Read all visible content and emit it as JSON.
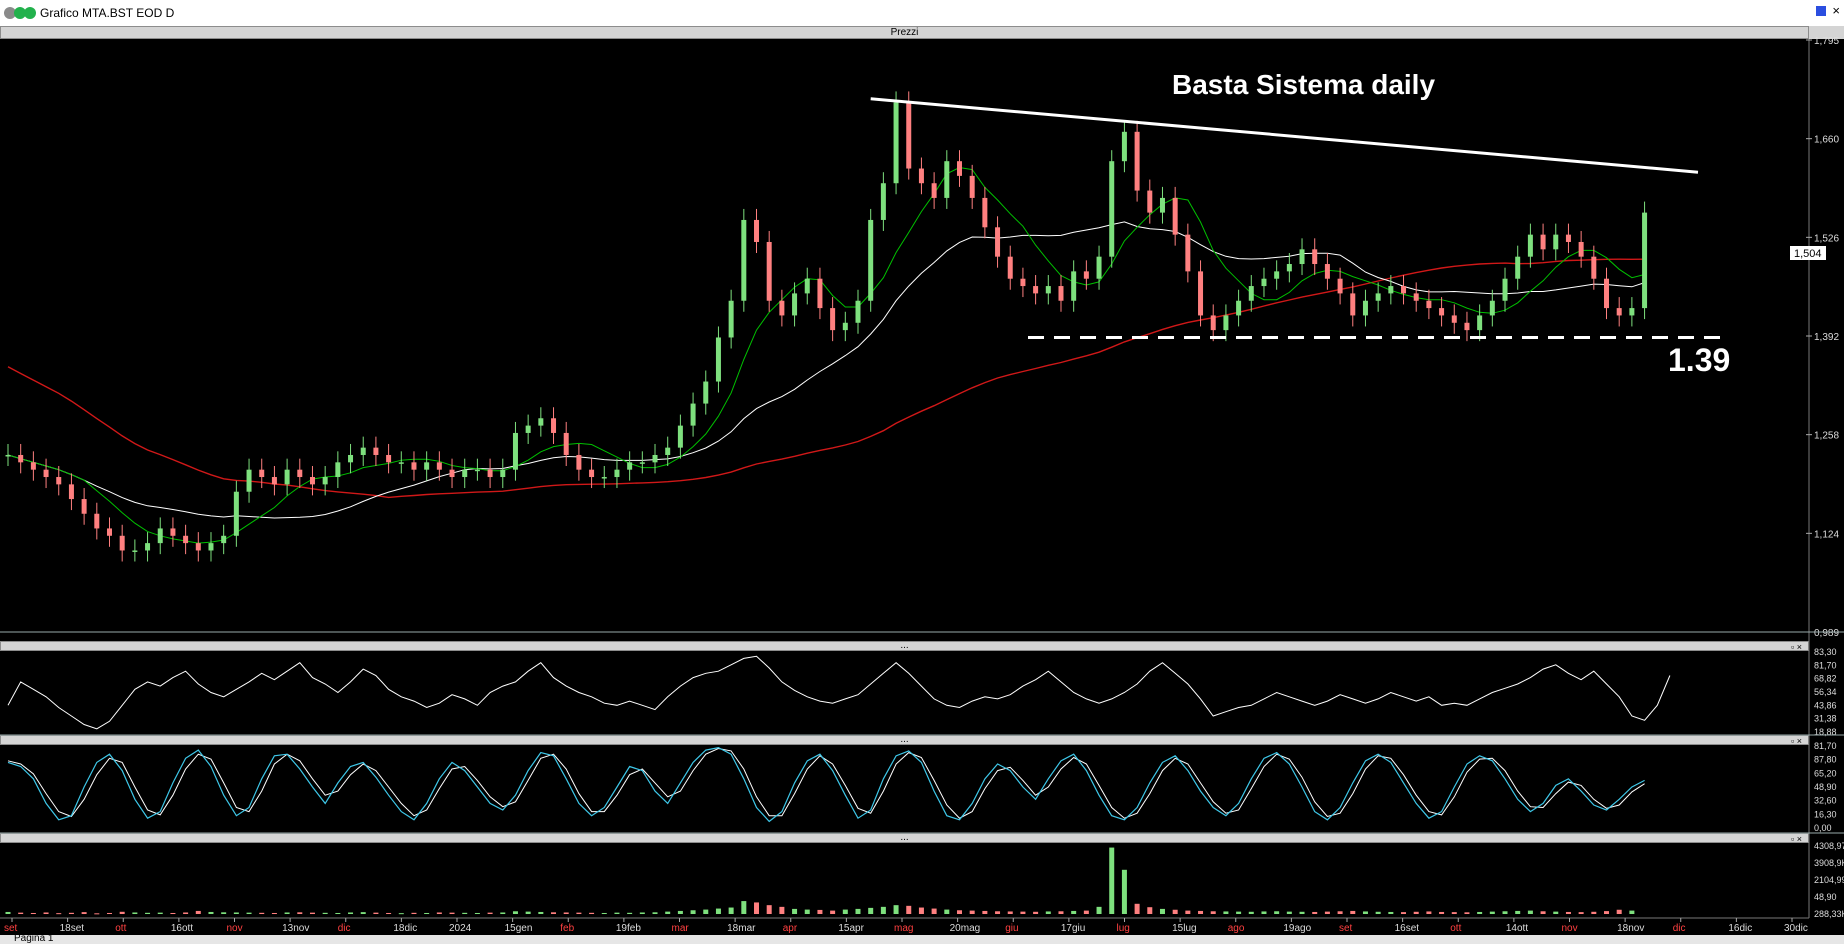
{
  "window": {
    "title": "Grafico MTA.BST EOD D"
  },
  "panels": {
    "price_label": "Prezzi",
    "sub_label": "..."
  },
  "status": {
    "page_tab": "Pagina 1"
  },
  "annotations": {
    "title": "Basta Sistema daily",
    "support_label": "1.39",
    "last_price": "1,504"
  },
  "colors": {
    "background": "#000000",
    "bull_candle": "#7ee07e",
    "bear_candle": "#ff8080",
    "ma_short": "#00c000",
    "ma_mid": "#ffffff",
    "ma_long": "#d01818",
    "stoch_k": "#3ec7e8",
    "stoch_d": "#ffffff"
  },
  "chart_data": [
    {
      "type": "line",
      "title": "Basta Sistema daily",
      "subtitle": "Prezzi",
      "ylim": [
        0.989,
        1.795
      ],
      "y_ticks": [
        "1,795",
        "1,660",
        "1,526",
        "1,392",
        "1,258",
        "1,124",
        "0,989"
      ],
      "x_ticks": [
        "set",
        "18set",
        "ott",
        "16ott",
        "nov",
        "13nov",
        "dic",
        "18dic",
        "2024",
        "15gen",
        "feb",
        "19feb",
        "mar",
        "18mar",
        "apr",
        "15apr",
        "mag",
        "20mag",
        "giu",
        "17giu",
        "lug",
        "15lug",
        "ago",
        "19ago",
        "set",
        "16set",
        "ott",
        "14ott",
        "nov",
        "18nov",
        "dic",
        "16dic",
        "30dic"
      ],
      "series": [
        {
          "values": [
            1.23,
            1.22,
            1.21,
            1.2,
            1.19,
            1.17,
            1.15,
            1.13,
            1.12,
            1.1,
            1.1,
            1.11,
            1.13,
            1.12,
            1.11,
            1.1,
            1.11,
            1.12,
            1.18,
            1.21,
            1.2,
            1.19,
            1.21,
            1.2,
            1.19,
            1.2,
            1.22,
            1.23,
            1.24,
            1.23,
            1.22,
            1.22,
            1.21,
            1.22,
            1.21,
            1.2,
            1.21,
            1.21,
            1.2,
            1.21,
            1.26,
            1.27,
            1.28,
            1.26,
            1.23,
            1.21,
            1.2,
            1.2,
            1.21,
            1.22,
            1.22,
            1.23,
            1.24,
            1.27,
            1.3,
            1.33,
            1.39,
            1.44,
            1.55,
            1.52,
            1.44,
            1.42,
            1.45,
            1.47,
            1.43,
            1.4,
            1.41,
            1.44,
            1.55,
            1.6,
            1.71,
            1.62,
            1.6,
            1.58,
            1.63,
            1.61,
            1.58,
            1.54,
            1.5,
            1.47,
            1.46,
            1.45,
            1.46,
            1.44,
            1.48,
            1.47,
            1.5,
            1.63,
            1.67,
            1.59,
            1.56,
            1.58,
            1.53,
            1.48,
            1.42,
            1.4,
            1.42,
            1.44,
            1.46,
            1.47,
            1.48,
            1.49,
            1.51,
            1.49,
            1.47,
            1.45,
            1.42,
            1.44,
            1.45,
            1.46,
            1.45,
            1.44,
            1.43,
            1.42,
            1.41,
            1.4,
            1.42,
            1.44,
            1.47,
            1.5,
            1.53,
            1.51,
            1.53,
            1.52,
            1.5,
            1.47,
            1.43,
            1.42,
            1.43,
            1.56
          ]
        }
      ],
      "annotations": [
        "1.39"
      ]
    },
    {
      "type": "line",
      "y_ticks": [
        "83,30",
        "81,70",
        "68,82",
        "56,34",
        "43,86",
        "31,38",
        "18,88"
      ],
      "series": [
        {
          "values": [
            40,
            62,
            55,
            48,
            38,
            30,
            22,
            18,
            25,
            40,
            55,
            62,
            58,
            66,
            72,
            60,
            52,
            48,
            55,
            62,
            70,
            64,
            72,
            80,
            66,
            60,
            52,
            62,
            74,
            68,
            55,
            48,
            44,
            38,
            42,
            50,
            46,
            40,
            52,
            58,
            62,
            72,
            80,
            66,
            58,
            52,
            48,
            42,
            40,
            44,
            40,
            36,
            48,
            58,
            66,
            70,
            72,
            78,
            84,
            86,
            75,
            62,
            54,
            48,
            44,
            42,
            46,
            50,
            60,
            70,
            80,
            70,
            58,
            46,
            40,
            38,
            44,
            48,
            46,
            50,
            58,
            64,
            72,
            62,
            52,
            46,
            42,
            46,
            52,
            60,
            72,
            80,
            70,
            60,
            46,
            30,
            34,
            38,
            40,
            46,
            52,
            48,
            44,
            40,
            44,
            50,
            46,
            42,
            46,
            52,
            48,
            44,
            48,
            40,
            42,
            40,
            46,
            52,
            56,
            60,
            66,
            74,
            78,
            70,
            64,
            72,
            60,
            48,
            30,
            26,
            40,
            68
          ]
        }
      ]
    },
    {
      "type": "line",
      "y_ticks": [
        "81,70",
        "87,80",
        "65,20",
        "48,90",
        "32,60",
        "16,30",
        "0,00"
      ],
      "series": [
        {
          "name": "%K",
          "values": [
            80,
            75,
            60,
            30,
            10,
            15,
            50,
            80,
            90,
            70,
            35,
            12,
            20,
            55,
            85,
            95,
            75,
            40,
            15,
            25,
            60,
            88,
            90,
            72,
            50,
            30,
            55,
            75,
            80,
            62,
            40,
            20,
            10,
            30,
            60,
            80,
            70,
            50,
            30,
            22,
            40,
            70,
            92,
            88,
            60,
            30,
            15,
            25,
            50,
            75,
            70,
            45,
            30,
            55,
            80,
            95,
            98,
            90,
            60,
            25,
            8,
            20,
            55,
            82,
            90,
            70,
            40,
            12,
            22,
            60,
            88,
            94,
            80,
            45,
            15,
            10,
            30,
            60,
            78,
            70,
            50,
            35,
            60,
            82,
            90,
            70,
            40,
            15,
            10,
            25,
            55,
            80,
            88,
            70,
            45,
            25,
            15,
            30,
            60,
            85,
            92,
            78,
            50,
            20,
            10,
            25,
            55,
            82,
            90,
            80,
            55,
            30,
            12,
            20,
            50,
            78,
            88,
            82,
            60,
            35,
            20,
            30,
            52,
            60,
            45,
            28,
            22,
            35,
            50,
            58
          ]
        },
        {
          "name": "%D",
          "values": [
            82,
            78,
            66,
            42,
            20,
            14,
            35,
            65,
            85,
            80,
            50,
            22,
            16,
            40,
            72,
            90,
            84,
            55,
            25,
            20,
            45,
            78,
            90,
            82,
            60,
            40,
            45,
            65,
            78,
            70,
            50,
            30,
            15,
            22,
            48,
            72,
            75,
            58,
            38,
            26,
            32,
            58,
            85,
            90,
            72,
            42,
            20,
            20,
            40,
            65,
            72,
            55,
            38,
            45,
            70,
            90,
            97,
            94,
            72,
            38,
            15,
            15,
            42,
            72,
            88,
            78,
            52,
            24,
            18,
            45,
            78,
            92,
            86,
            58,
            28,
            12,
            20,
            48,
            70,
            74,
            58,
            40,
            50,
            72,
            86,
            78,
            52,
            25,
            12,
            18,
            42,
            70,
            85,
            78,
            55,
            32,
            18,
            22,
            48,
            75,
            90,
            84,
            62,
            32,
            14,
            18,
            42,
            72,
            88,
            85,
            65,
            40,
            20,
            16,
            38,
            68,
            84,
            85,
            70,
            45,
            26,
            25,
            42,
            56,
            52,
            35,
            24,
            28,
            44,
            54
          ]
        }
      ]
    },
    {
      "type": "bar",
      "y_ticks": [
        "4308,97K",
        "3908,9K",
        "2104,99K",
        "48,90",
        "288,33K"
      ],
      "values": [
        120,
        80,
        60,
        90,
        50,
        70,
        110,
        40,
        60,
        130,
        90,
        70,
        80,
        60,
        90,
        180,
        120,
        100,
        90,
        80,
        70,
        60,
        90,
        100,
        80,
        70,
        60,
        90,
        110,
        80,
        60,
        50,
        70,
        60,
        90,
        80,
        70,
        60,
        80,
        90,
        160,
        140,
        120,
        100,
        90,
        80,
        70,
        60,
        80,
        70,
        90,
        100,
        140,
        180,
        220,
        260,
        320,
        380,
        760,
        680,
        520,
        420,
        300,
        260,
        240,
        200,
        260,
        300,
        360,
        420,
        520,
        480,
        380,
        320,
        260,
        220,
        200,
        180,
        160,
        150,
        140,
        130,
        150,
        160,
        180,
        200,
        420,
        3908,
        2600,
        600,
        400,
        300,
        250,
        200,
        180,
        160,
        150,
        140,
        130,
        150,
        160,
        140,
        130,
        120,
        140,
        160,
        180,
        150,
        130,
        120,
        110,
        130,
        150,
        120,
        110,
        100,
        120,
        140,
        160,
        180,
        200,
        160,
        140,
        120,
        110,
        130,
        170,
        250,
        200
      ]
    }
  ]
}
